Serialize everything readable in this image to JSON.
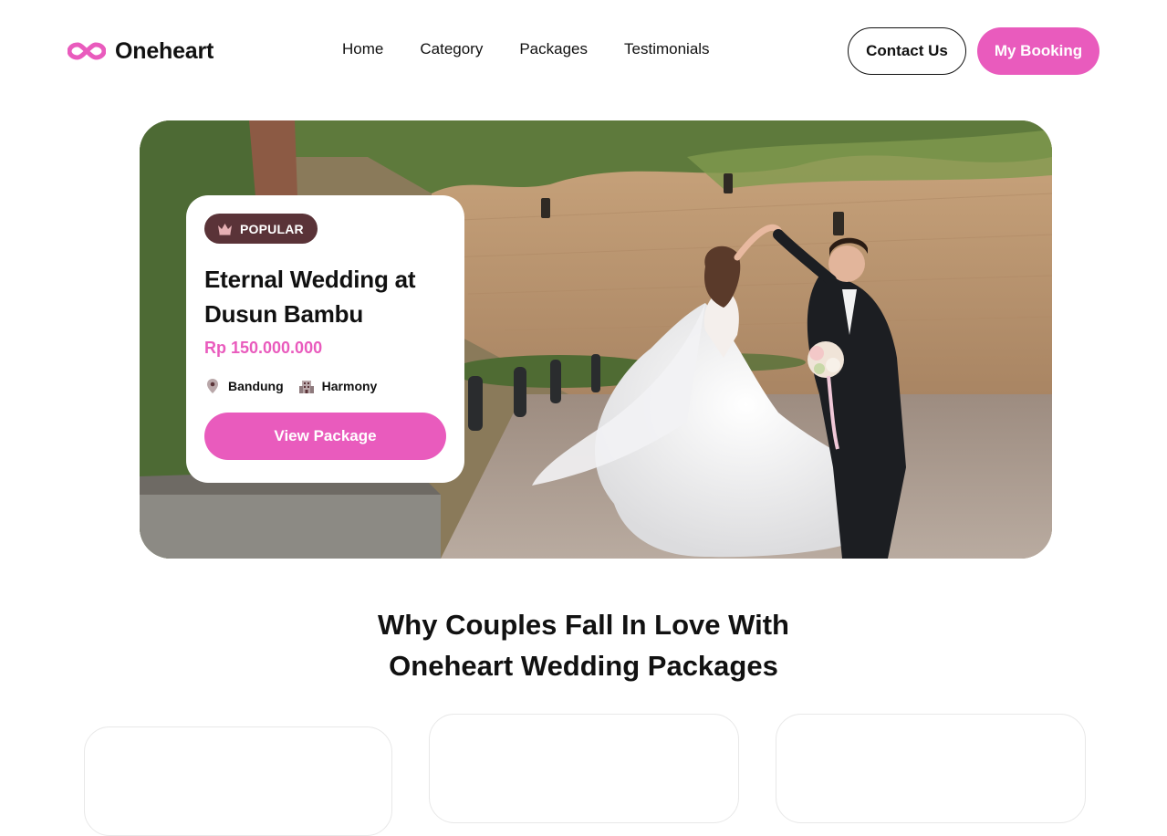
{
  "brand": {
    "name": "Oneheart",
    "accent": "#e95bbd",
    "logo_icon": "infinity-icon"
  },
  "nav": {
    "items": [
      {
        "label": "Home"
      },
      {
        "label": "Category"
      },
      {
        "label": "Packages"
      },
      {
        "label": "Testimonials"
      }
    ]
  },
  "header": {
    "contact_label": "Contact Us",
    "booking_label": "My Booking"
  },
  "hero": {
    "photo": "wedding-couple-dancing-photo",
    "badge": {
      "label": "POPULAR",
      "icon": "crown-icon",
      "color": "#5a3338"
    },
    "title_line1": "Eternal Wedding at",
    "title_line2": "Dusun Bambu",
    "price": "Rp 150.000.000",
    "location": {
      "label": "Bandung",
      "icon": "location-pin-icon"
    },
    "venue": {
      "label": "Harmony",
      "icon": "building-icon"
    },
    "cta_label": "View Package"
  },
  "section": {
    "title_line1": "Why Couples Fall In Love With",
    "title_line2": "Oneheart Wedding Packages"
  }
}
